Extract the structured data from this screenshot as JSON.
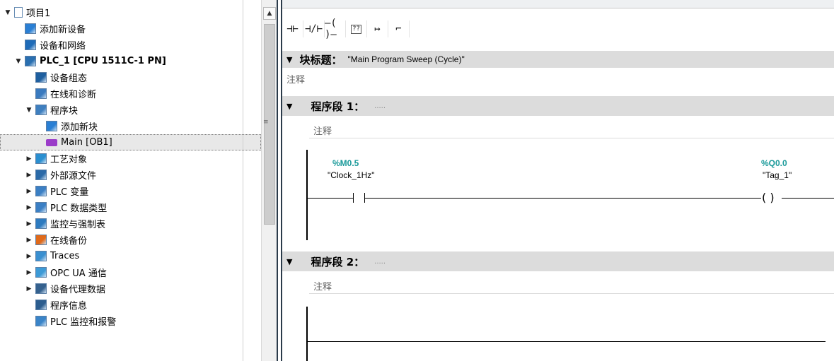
{
  "tree": {
    "items": [
      {
        "label": "项目1",
        "arrow": "▼",
        "icon": "project-icon"
      },
      {
        "label": "添加新设备",
        "arrow": "",
        "icon": "add-device-icon"
      },
      {
        "label": "设备和网络",
        "arrow": "",
        "icon": "network-icon"
      },
      {
        "label": "PLC_1 [CPU 1511C-1 PN]",
        "arrow": "▼",
        "icon": "plc-icon"
      },
      {
        "label": "设备组态",
        "arrow": "",
        "icon": "device-config-icon"
      },
      {
        "label": "在线和诊断",
        "arrow": "",
        "icon": "online-diagnostics-icon"
      },
      {
        "label": "程序块",
        "arrow": "▼",
        "icon": "program-blocks-folder-icon"
      },
      {
        "label": "添加新块",
        "arrow": "",
        "icon": "add-block-icon"
      },
      {
        "label": "Main [OB1]",
        "arrow": "",
        "icon": "ob-block-icon"
      },
      {
        "label": "工艺对象",
        "arrow": "▶",
        "icon": "technology-objects-icon"
      },
      {
        "label": "外部源文件",
        "arrow": "▶",
        "icon": "external-source-icon"
      },
      {
        "label": "PLC 变量",
        "arrow": "▶",
        "icon": "plc-tags-icon"
      },
      {
        "label": "PLC 数据类型",
        "arrow": "▶",
        "icon": "plc-datatypes-icon"
      },
      {
        "label": "监控与强制表",
        "arrow": "▶",
        "icon": "watch-table-icon"
      },
      {
        "label": "在线备份",
        "arrow": "▶",
        "icon": "online-backup-icon"
      },
      {
        "label": "Traces",
        "arrow": "▶",
        "icon": "traces-icon"
      },
      {
        "label": "OPC UA 通信",
        "arrow": "▶",
        "icon": "opcua-icon"
      },
      {
        "label": "设备代理数据",
        "arrow": "▶",
        "icon": "device-proxy-icon"
      },
      {
        "label": "程序信息",
        "arrow": "",
        "icon": "program-info-icon"
      },
      {
        "label": "PLC 监控和报警",
        "arrow": "",
        "icon": "plc-alarms-icon"
      }
    ]
  },
  "toolbar": {
    "items": [
      "⊣⊢",
      "⊣/⊢",
      "–( )–",
      "??",
      "↦",
      "⌐"
    ]
  },
  "block": {
    "title_label": "块标题：",
    "title_value": "\"Main Program Sweep (Cycle)\"",
    "comment": "注释"
  },
  "networks": [
    {
      "label": "程序段 1：",
      "dots": ".....",
      "comment": "注释",
      "contact_address": "%M0.5",
      "contact_tag": "\"Clock_1Hz\"",
      "coil_address": "%Q0.0",
      "coil_tag": "\"Tag_1\""
    },
    {
      "label": "程序段 2：",
      "dots": ".....",
      "comment": "注释"
    }
  ],
  "colors": {
    "address": "#1a9a9a",
    "band": "#dcdcdc",
    "selection": "#e8e8e8"
  }
}
